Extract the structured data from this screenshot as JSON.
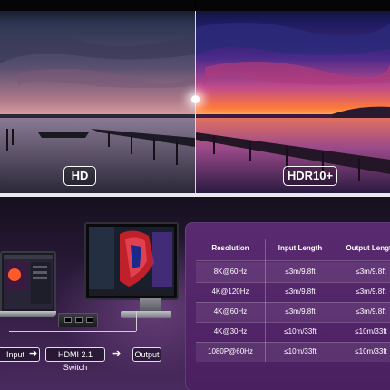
{
  "comparison": {
    "left_label": "HD",
    "right_label": "HDR10+"
  },
  "setup": {
    "input_label": "Input",
    "switch_label": "HDMI 2.1 Switch",
    "output_label": "Output"
  },
  "table": {
    "headers": [
      "Resolution",
      "Input Length",
      "Output Length"
    ],
    "rows": [
      [
        "8K@60Hz",
        "≤3m/9.8ft",
        "≤3m/9.8ft"
      ],
      [
        "4K@120Hz",
        "≤3m/9.8ft",
        "≤3m/9.8ft"
      ],
      [
        "4K@60Hz",
        "≤3m/9.8ft",
        "≤3m/9.8ft"
      ],
      [
        "4K@30Hz",
        "≤10m/33ft",
        "≤10m/33ft"
      ],
      [
        "1080P@60Hz",
        "≤10m/33ft",
        "≤10m/33ft"
      ]
    ]
  },
  "colors": {
    "hd_sky_top": "#2a3550",
    "hdr_sky_top": "#2a1a6a",
    "hdr_horizon": "#ff7a3a",
    "card_purple": "#5a2a70"
  }
}
